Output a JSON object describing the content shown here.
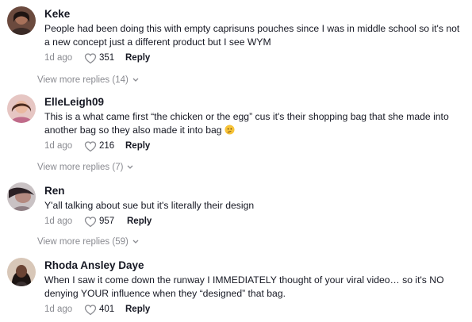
{
  "comments": [
    {
      "username": "Keke",
      "text": "People had been doing this with empty caprisuns pouches since I was in middle school so it's not a new concept just a different product but I see WYM",
      "time": "1d ago",
      "likes": "351",
      "reply_label": "Reply",
      "more_replies": "View more replies (14)"
    },
    {
      "username": "ElleLeigh09",
      "text": "This is a what came first “the chicken or the egg” cus it's their shopping bag that she made into another bag so they also made it into bag",
      "emoji": "thinking-face",
      "time": "1d ago",
      "likes": "216",
      "reply_label": "Reply",
      "more_replies": "View more replies (7)"
    },
    {
      "username": "Ren",
      "text": "Y'all talking about sue but it's literally their design",
      "time": "1d ago",
      "likes": "957",
      "reply_label": "Reply",
      "more_replies": "View more replies (59)"
    },
    {
      "username": "Rhoda Ansley Daye",
      "text": "When I saw it come down the runway I IMMEDIATELY thought of your viral video… so it's NO denying YOUR influence when they “designed” that bag.",
      "time": "1d ago",
      "likes": "401",
      "reply_label": "Reply"
    }
  ],
  "colors": {
    "text": "#161823",
    "muted": "#8a8b91"
  }
}
